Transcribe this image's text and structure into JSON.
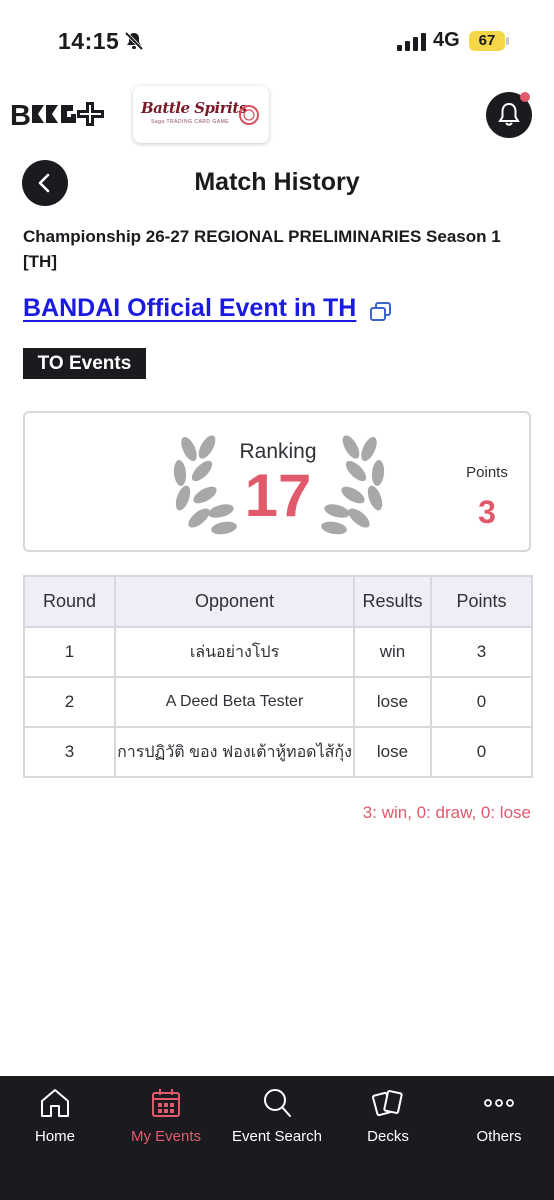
{
  "status_bar": {
    "time": "14:15",
    "network": "4G",
    "battery": "67"
  },
  "header": {
    "app_logo": "BCG+",
    "game_logo": "Battle Spirits",
    "game_logo_sub": "Saga TRADING CARD GAME"
  },
  "title": "Match History",
  "event": {
    "name": "Championship 26-27 REGIONAL PRELIMINARIES Season 1 [TH]",
    "organizer_link": "BANDAI Official Event in TH",
    "badge": "TO Events"
  },
  "summary": {
    "ranking_label": "Ranking",
    "ranking_value": "17",
    "points_label": "Points",
    "points_value": "3"
  },
  "table": {
    "headers": [
      "Round",
      "Opponent",
      "Results",
      "Points"
    ],
    "rows": [
      {
        "round": "1",
        "opponent": "เล่นอย่างโปร",
        "result": "win",
        "points": "3"
      },
      {
        "round": "2",
        "opponent": "A Deed Beta Tester",
        "result": "lose",
        "points": "0"
      },
      {
        "round": "3",
        "opponent": "การปฏิวัติ ของ ฟองเต้าหู้ทอดไส้กุ้ง",
        "result": "lose",
        "points": "0"
      }
    ]
  },
  "legend": "3: win, 0: draw, 0: lose",
  "tabs": [
    {
      "label": "Home",
      "icon": "home-icon"
    },
    {
      "label": "My Events",
      "icon": "calendar-icon",
      "active": true
    },
    {
      "label": "Event Search",
      "icon": "search-icon"
    },
    {
      "label": "Decks",
      "icon": "cards-icon"
    },
    {
      "label": "Others",
      "icon": "more-icon"
    }
  ],
  "colors": {
    "accent": "#e05a6b",
    "dark": "#1b1b1f",
    "link": "#1a1ae0",
    "table_header": "#eeeef7"
  }
}
